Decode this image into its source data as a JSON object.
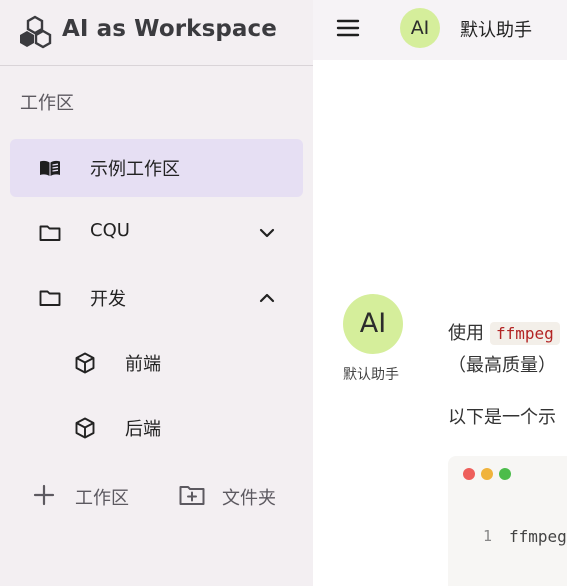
{
  "brand": {
    "title": "AI as Workspace",
    "icon": "hexagon-cluster-logo-icon"
  },
  "sidebar": {
    "section_label": "工作区",
    "items": [
      {
        "label": "示例工作区",
        "icon": "open-book-icon",
        "active": true
      },
      {
        "label": "CQU",
        "icon": "folder-icon",
        "chevron": "chevron-down-icon"
      },
      {
        "label": "开发",
        "icon": "folder-icon",
        "chevron": "chevron-up-icon"
      },
      {
        "label": "前端",
        "icon": "cube-icon"
      },
      {
        "label": "后端",
        "icon": "cube-icon"
      }
    ],
    "add_workspace_label": "工作区",
    "add_folder_label": "文件夹"
  },
  "header": {
    "avatar_text": "AI",
    "assistant_name": "默认助手"
  },
  "chat": {
    "avatar_text": "AI",
    "avatar_name": "默认助手",
    "line1_prefix": "使用",
    "line1_code": "ffmpeg",
    "line2": "（最高质量）",
    "line3": "以下是一个示",
    "code_line_no": "1",
    "code_line": "ffmpeg"
  },
  "colors": {
    "sidebar_bg": "#f3eff2",
    "active_item_bg": "#e6dff3",
    "avatar_bg": "#d5ee9b",
    "inline_code_text": "#b32424"
  }
}
